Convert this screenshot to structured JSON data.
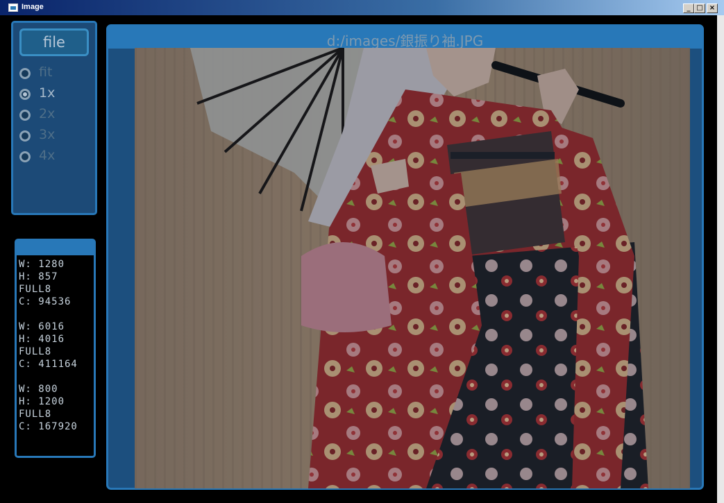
{
  "window": {
    "title": "Image",
    "buttons": {
      "minimize": "_",
      "maximize": "□",
      "close": "×"
    }
  },
  "controls": {
    "file_button": "file",
    "zoom_options": [
      {
        "label": "fit",
        "selected": false
      },
      {
        "label": "1x",
        "selected": true
      },
      {
        "label": "2x",
        "selected": false
      },
      {
        "label": "3x",
        "selected": false
      },
      {
        "label": "4x",
        "selected": false
      }
    ]
  },
  "info": {
    "entries": [
      {
        "w": "W: 1280",
        "h": "H: 857",
        "mode": "FULL8",
        "c": "C: 94536"
      },
      {
        "w": "W: 6016",
        "h": "H: 4016",
        "mode": "FULL8",
        "c": "C: 411164"
      },
      {
        "w": "W: 800",
        "h": "H: 1200",
        "mode": "FULL8",
        "c": "C: 167920"
      }
    ]
  },
  "viewer": {
    "path": "d:/images/銀振り袖.JPG",
    "image_description_icon": "photo-kimono-doll"
  },
  "colors": {
    "panel_border": "#2878b8",
    "panel_bg": "#1c4a77",
    "window_bg": "#000000"
  }
}
